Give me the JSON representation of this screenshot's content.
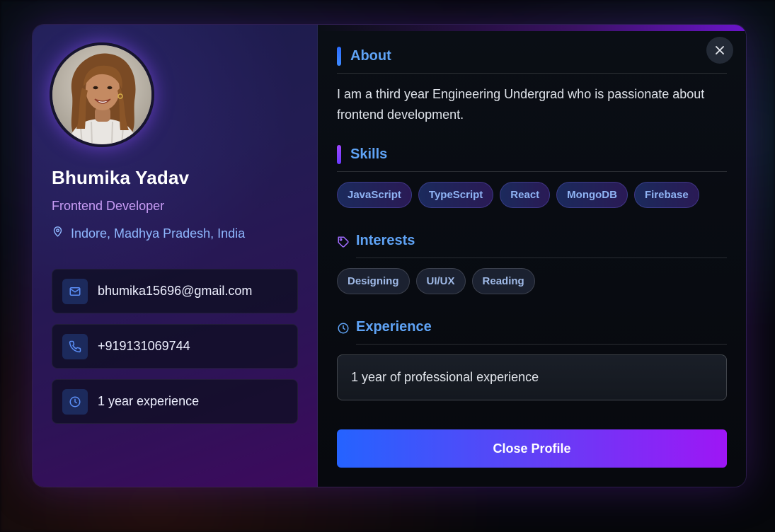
{
  "profile": {
    "name": "Bhumika Yadav",
    "role": "Frontend Developer",
    "location": "Indore, Madhya Pradesh, India"
  },
  "contacts": [
    {
      "icon": "mail-icon",
      "value": "bhumika15696@gmail.com"
    },
    {
      "icon": "phone-icon",
      "value": "+919131069744"
    },
    {
      "icon": "clock-icon",
      "value": "1 year experience"
    }
  ],
  "about": {
    "title": "About",
    "text": "I am a third year Engineering Undergrad who is passionate about frontend development."
  },
  "skills": {
    "title": "Skills",
    "items": [
      "JavaScript",
      "TypeScript",
      "React",
      "MongoDB",
      "Firebase"
    ]
  },
  "interests": {
    "title": "Interests",
    "items": [
      "Designing",
      "UI/UX",
      "Reading"
    ]
  },
  "experience": {
    "title": "Experience",
    "text": "1 year of professional experience"
  },
  "actions": {
    "close_profile_label": "Close Profile"
  },
  "colors": {
    "accent_blue": "#5fa3f5",
    "accent_purple": "#9e16f5",
    "role_text": "#c89cf5"
  }
}
